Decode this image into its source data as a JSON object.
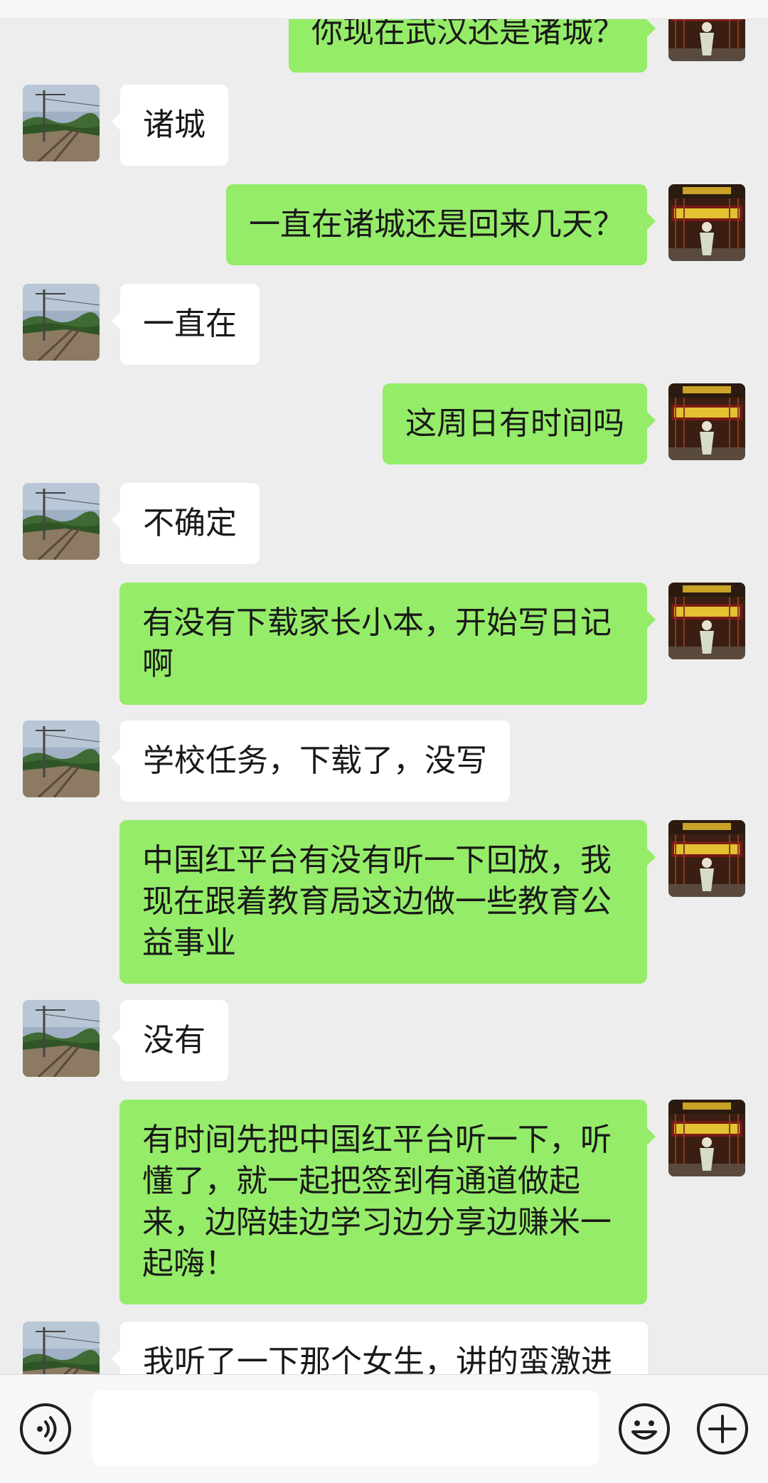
{
  "messages": [
    {
      "side": "out",
      "text": "你现在武汉还是诸城？"
    },
    {
      "side": "in",
      "text": "诸城"
    },
    {
      "side": "out",
      "text": "一直在诸城还是回来几天？"
    },
    {
      "side": "in",
      "text": "一直在"
    },
    {
      "side": "out",
      "text": "这周日有时间吗"
    },
    {
      "side": "in",
      "text": "不确定"
    },
    {
      "side": "out",
      "text": "有没有下载家长小本，开始写日记啊"
    },
    {
      "side": "in",
      "text": "学校任务，下载了，没写"
    },
    {
      "side": "out",
      "text": "中国红平台有没有听一下回放，我现在跟着教育局这边做一些教育公益事业"
    },
    {
      "side": "in",
      "text": "没有"
    },
    {
      "side": "out",
      "text": "有时间先把中国红平台听一下，听懂了，就一起把签到有通道做起来，边陪娃边学习边分享边赚米一起嗨！"
    },
    {
      "side": "in",
      "text": "我听了一下那个女生，讲的蛮激进"
    }
  ],
  "input_bar": {
    "voice_icon": "voice-icon",
    "message_value": "",
    "emoji_icon": "emoji-icon",
    "plus_icon": "plus-icon"
  },
  "colors": {
    "background": "#ededed",
    "outgoing_bubble": "#95ec69",
    "incoming_bubble": "#ffffff",
    "text": "#191919"
  }
}
